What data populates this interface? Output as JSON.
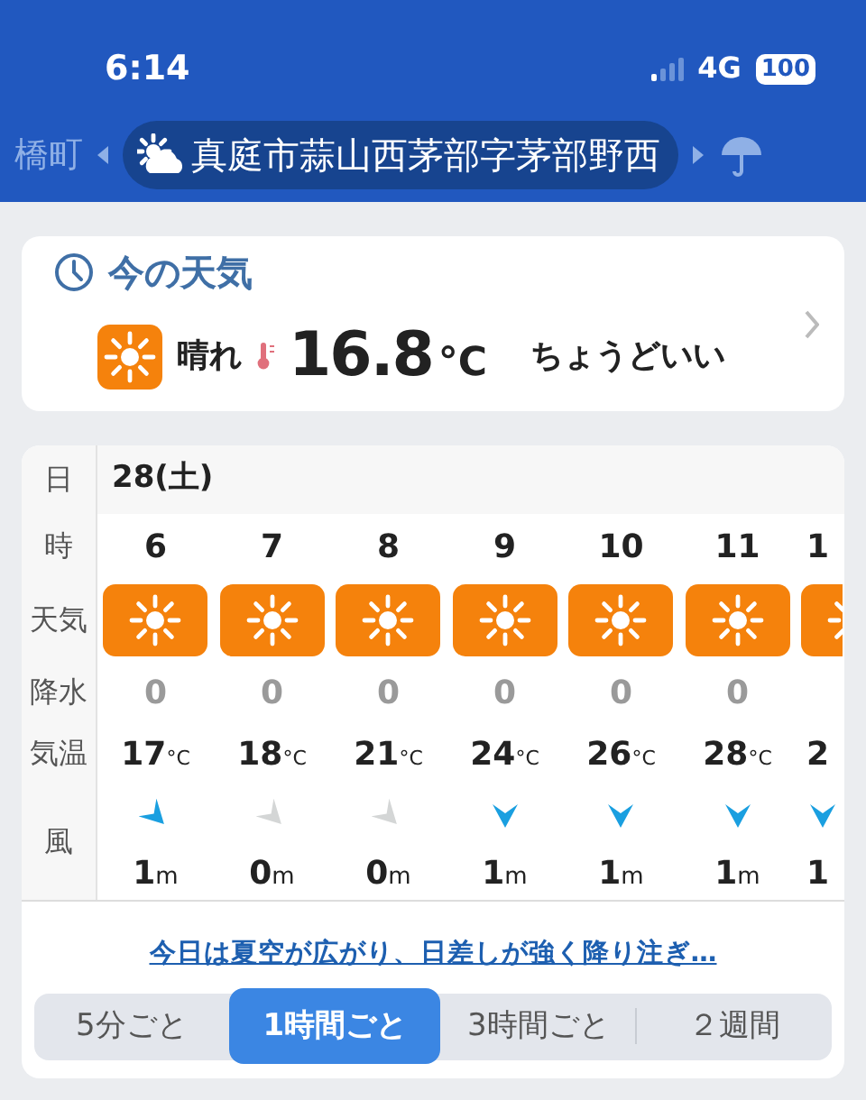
{
  "status_bar": {
    "time": "6:14",
    "network": "4G",
    "battery": "100"
  },
  "location_bar": {
    "prev": "橋町",
    "current": "真庭市蒜山西茅部字茅部野西"
  },
  "current_weather": {
    "title": "今の天気",
    "condition": "晴れ",
    "temperature": "16.8",
    "unit": "°C",
    "comment": "ちょうどいい"
  },
  "forecast": {
    "row_labels": [
      "日",
      "時",
      "天気",
      "降水",
      "気温",
      "風"
    ],
    "date": "28(土)",
    "hours": [
      {
        "hour": "6",
        "precip": "0",
        "temp": "17",
        "temp_unit": "°C",
        "kind": "northwest",
        "color": "#1a9fe0",
        "wind_speed": "1",
        "wind_unit": "m"
      },
      {
        "hour": "7",
        "precip": "0",
        "temp": "18",
        "temp_unit": "°C",
        "kind": "northwest",
        "color": "#d4d6d6",
        "wind_speed": "0",
        "wind_unit": "m"
      },
      {
        "hour": "8",
        "precip": "0",
        "temp": "21",
        "temp_unit": "°C",
        "kind": "northwest",
        "color": "#d4d6d6",
        "wind_speed": "0",
        "wind_unit": "m"
      },
      {
        "hour": "9",
        "precip": "0",
        "temp": "24",
        "temp_unit": "°C",
        "kind": "north",
        "color": "#1a9fe0",
        "wind_speed": "1",
        "wind_unit": "m"
      },
      {
        "hour": "10",
        "precip": "0",
        "temp": "26",
        "temp_unit": "°C",
        "kind": "north",
        "color": "#1a9fe0",
        "wind_speed": "1",
        "wind_unit": "m"
      },
      {
        "hour": "11",
        "precip": "0",
        "temp": "28",
        "temp_unit": "°C",
        "kind": "north",
        "color": "#1a9fe0",
        "wind_speed": "1",
        "wind_unit": "m"
      },
      {
        "hour": "1",
        "temp": "2",
        "kind": "north",
        "color": "#1a9fe0",
        "wind_speed": "1"
      }
    ],
    "summary_link": "今日は夏空が広がり、日差しが強く降り注ぎ…",
    "intervals": [
      {
        "label": "5分ごと",
        "selected": false
      },
      {
        "label": "1時間ごと",
        "selected": true
      },
      {
        "label": "3時間ごと",
        "selected": false
      },
      {
        "label": "２週間",
        "selected": false
      }
    ]
  }
}
